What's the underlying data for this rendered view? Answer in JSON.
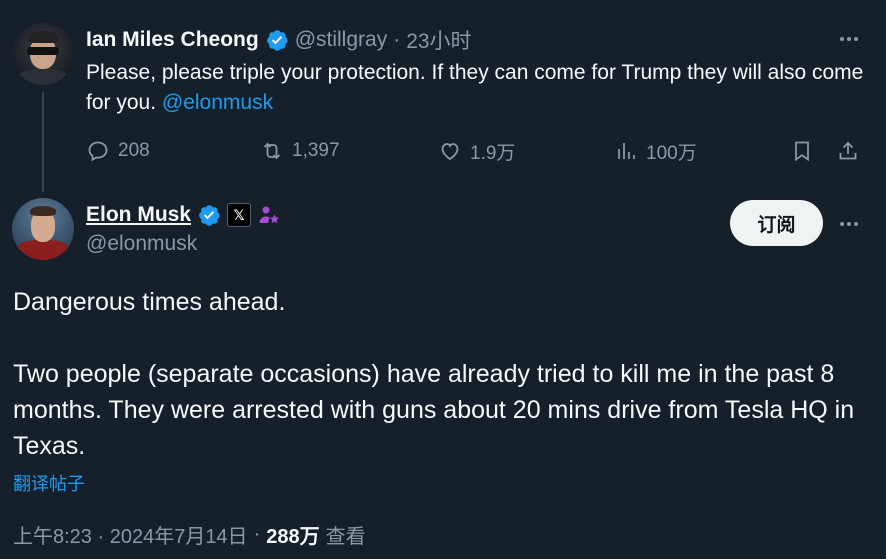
{
  "parent_tweet": {
    "display_name": "Ian Miles Cheong",
    "handle": "@stillgray",
    "separator": "·",
    "time": "23小时",
    "text_before_mention": "Please, please triple your protection. If they can come for Trump they will also come for you. ",
    "mention": "@elonmusk",
    "stats": {
      "replies": "208",
      "retweets": "1,397",
      "likes": "1.9万",
      "views": "100万"
    }
  },
  "main_tweet": {
    "display_name": "Elon Musk",
    "handle": "@elonmusk",
    "badge_x": "𝕏",
    "subscribe_label": "订阅",
    "paragraph1": "Dangerous times ahead.",
    "paragraph2": "Two people (separate occasions) have already tried to kill me in the past 8 months. They were arrested with guns about 20 mins drive from Tesla HQ in Texas.",
    "translate_label": "翻译帖子",
    "timestamp": "上午8:23 · 2024年7月14日",
    "meta_separator": "·",
    "views_count": "288万",
    "views_label": "查看"
  },
  "colors": {
    "background": "#15202b",
    "text": "#f7f9f9",
    "muted": "#8b98a5",
    "link": "#1d9bf0",
    "verified": "#1d9bf0",
    "affiliate_badge": "#a44dd4"
  },
  "icons": [
    "reply-icon",
    "retweet-icon",
    "like-icon",
    "views-icon",
    "bookmark-icon",
    "share-icon",
    "more-icon",
    "verified-icon",
    "x-badge-icon",
    "affiliate-icon"
  ]
}
